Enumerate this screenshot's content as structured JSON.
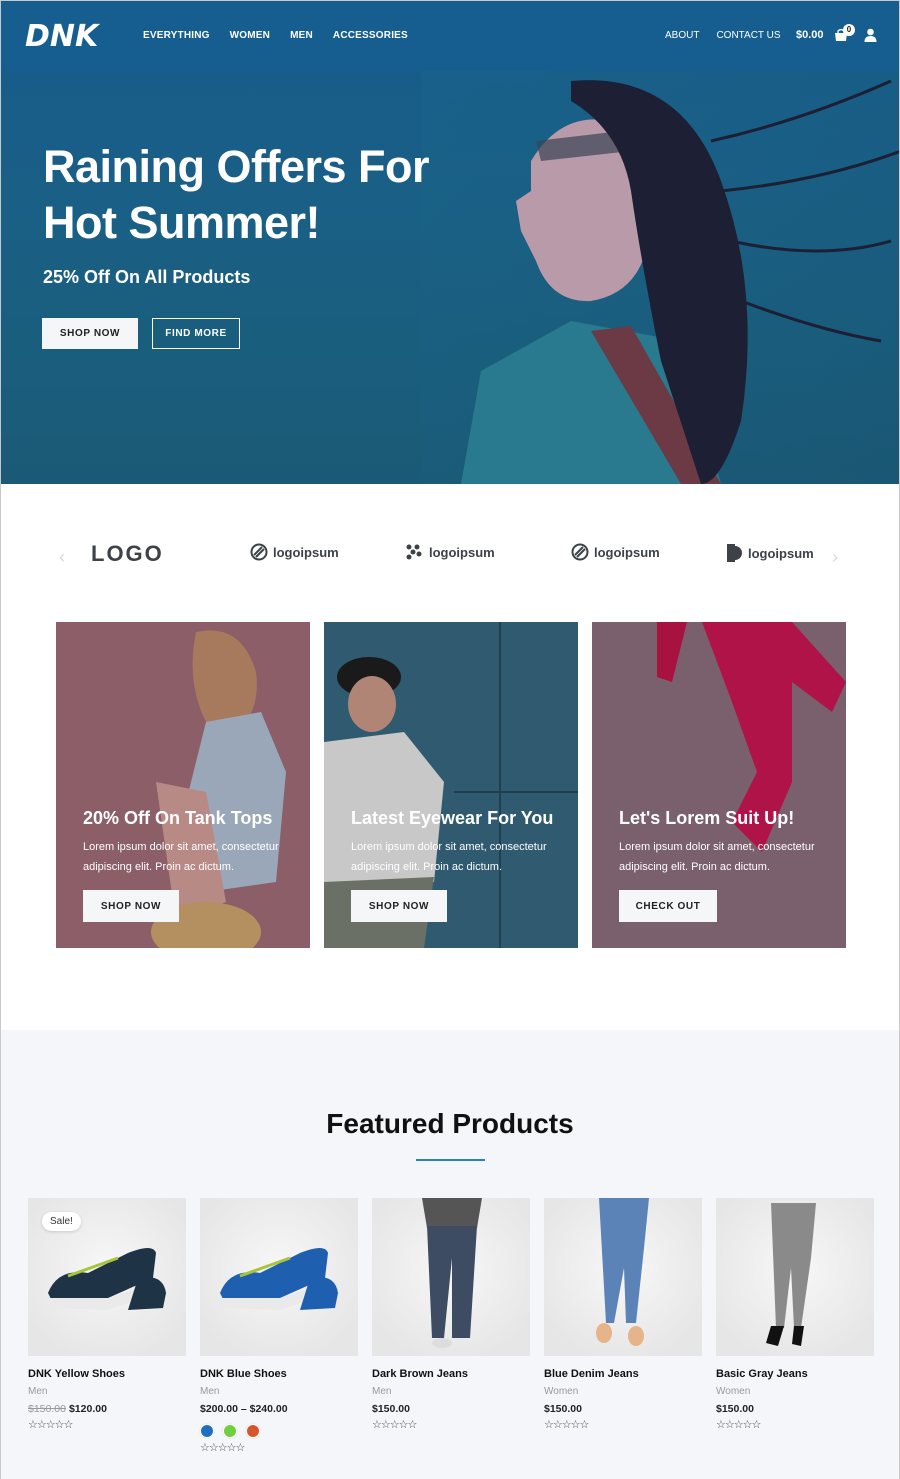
{
  "header": {
    "logo_text": "DNK",
    "nav": [
      "EVERYTHING",
      "WOMEN",
      "MEN",
      "ACCESSORIES"
    ],
    "nav_right": [
      "ABOUT",
      "CONTACT US"
    ],
    "cart_total": "$0.00",
    "cart_count": "0"
  },
  "hero": {
    "title": "Raining Offers For Hot Summer!",
    "subtitle": "25% Off On All Products",
    "primary_button": "SHOP NOW",
    "secondary_button": "FIND MORE"
  },
  "logos": {
    "items": [
      "LOGO",
      "logoipsum",
      "logoipsum",
      "logoipsum",
      "logoipsum"
    ],
    "prev_icon": "chevron-left-icon",
    "next_icon": "chevron-right-icon"
  },
  "promos": [
    {
      "title": "20% Off On Tank Tops",
      "text": "Lorem ipsum dolor sit amet, consectetur adipiscing elit. Proin ac dictum.",
      "button": "SHOP NOW"
    },
    {
      "title": "Latest Eyewear For You",
      "text": "Lorem ipsum dolor sit amet, consectetur adipiscing elit. Proin ac dictum.",
      "button": "SHOP NOW"
    },
    {
      "title": "Let's Lorem Suit Up!",
      "text": "Lorem ipsum dolor sit amet, consectetur adipiscing elit. Proin ac dictum.",
      "button": "CHECK OUT"
    }
  ],
  "featured": {
    "title": "Featured Products",
    "accent_color": "#2b7fc1",
    "products": [
      {
        "name": "DNK Yellow Shoes",
        "category": "Men",
        "old_price": "$150.00",
        "price": "$120.00",
        "badge": "Sale!",
        "rating": "☆☆☆☆☆"
      },
      {
        "name": "DNK Blue Shoes",
        "category": "Men",
        "price": "$200.00 – $240.00",
        "rating": "☆☆☆☆☆",
        "swatches": [
          "#1e6fbf",
          "#6fcf3c",
          "#d4562a"
        ]
      },
      {
        "name": "Dark Brown Jeans",
        "category": "Men",
        "price": "$150.00",
        "rating": "☆☆☆☆☆"
      },
      {
        "name": "Blue Denim Jeans",
        "category": "Women",
        "price": "$150.00",
        "rating": "☆☆☆☆☆"
      },
      {
        "name": "Basic Gray Jeans",
        "category": "Women",
        "price": "$150.00",
        "rating": "☆☆☆☆☆"
      }
    ]
  }
}
